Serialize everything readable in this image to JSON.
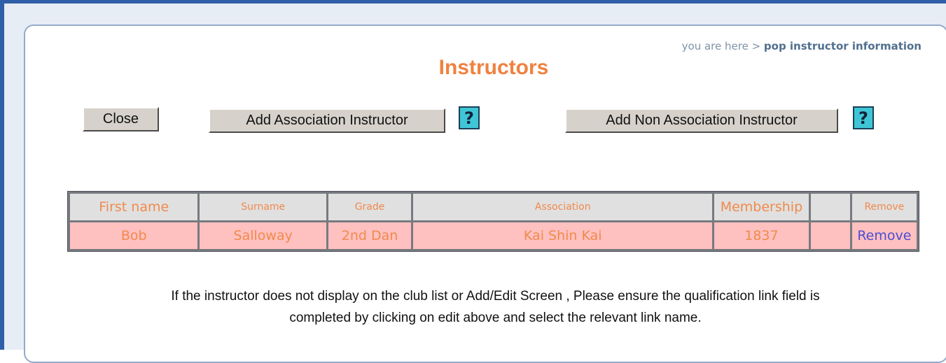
{
  "breadcrumb": {
    "prefix": "you are here > ",
    "current": "pop instructor information"
  },
  "page_title": "Instructors",
  "buttons": {
    "close": "Close",
    "add_association": "Add Association Instructor",
    "add_non_association": "Add Non Association Instructor",
    "help": "?"
  },
  "colors": {
    "title": "#f0813f",
    "row_bg": "#ffc0c0",
    "header_bg": "#e0e0e0",
    "link": "#4b4ed1"
  },
  "table": {
    "headers": [
      "First name",
      "Surname",
      "Grade",
      "Association",
      "Membership",
      "",
      "Remove"
    ],
    "rows": [
      {
        "first_name": "Bob",
        "surname": "Salloway",
        "grade": "2nd Dan",
        "association": "Kai Shin Kai",
        "membership": "1837",
        "blank": "",
        "remove": "Remove"
      }
    ]
  },
  "note": {
    "line1": "If the instructor does not display on the club list or Add/Edit Screen  , Please ensure the qualification link field is",
    "line2": "completed by clicking on edit above and select the relevant link name."
  }
}
